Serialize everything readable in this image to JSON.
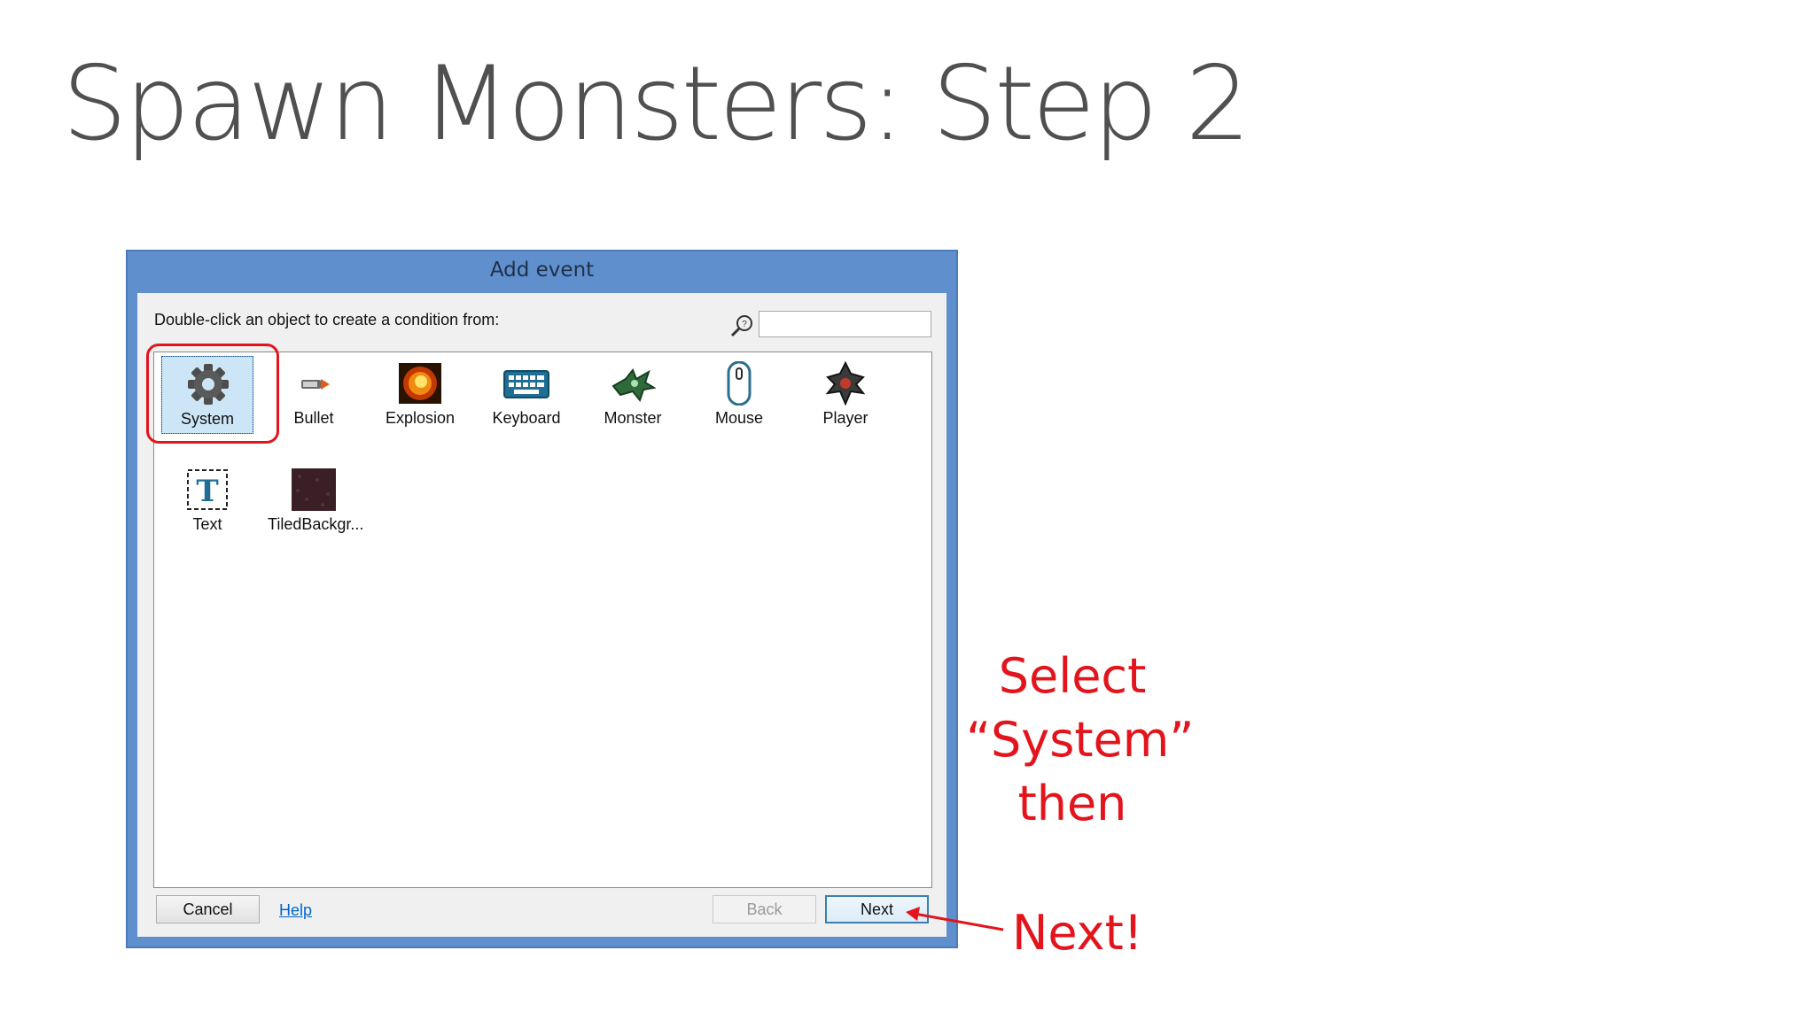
{
  "slide": {
    "title": "Spawn Monsters: Step 2"
  },
  "dialog": {
    "title": "Add event",
    "instruction": "Double-click an object to create a condition from:",
    "search": {
      "value": "",
      "placeholder": ""
    },
    "objects": [
      {
        "label": "System",
        "icon": "gear-icon",
        "selected": true
      },
      {
        "label": "Bullet",
        "icon": "bullet-icon"
      },
      {
        "label": "Explosion",
        "icon": "explosion-icon"
      },
      {
        "label": "Keyboard",
        "icon": "keyboard-icon"
      },
      {
        "label": "Monster",
        "icon": "monster-icon"
      },
      {
        "label": "Mouse",
        "icon": "mouse-icon"
      },
      {
        "label": "Player",
        "icon": "player-icon"
      },
      {
        "label": "Text",
        "icon": "text-icon"
      },
      {
        "label": "TiledBackgr...",
        "icon": "tiled-background-icon"
      }
    ],
    "buttons": {
      "cancel": "Cancel",
      "help": "Help",
      "back": "Back",
      "next": "Next"
    }
  },
  "annotation": {
    "line1": "Select",
    "line2": "“System”",
    "line3": "then",
    "next": "Next!",
    "color": "#e3141b"
  },
  "colors": {
    "window_frame": "#5f8fcd",
    "highlight": "#e3141b",
    "link": "#0066cc"
  }
}
